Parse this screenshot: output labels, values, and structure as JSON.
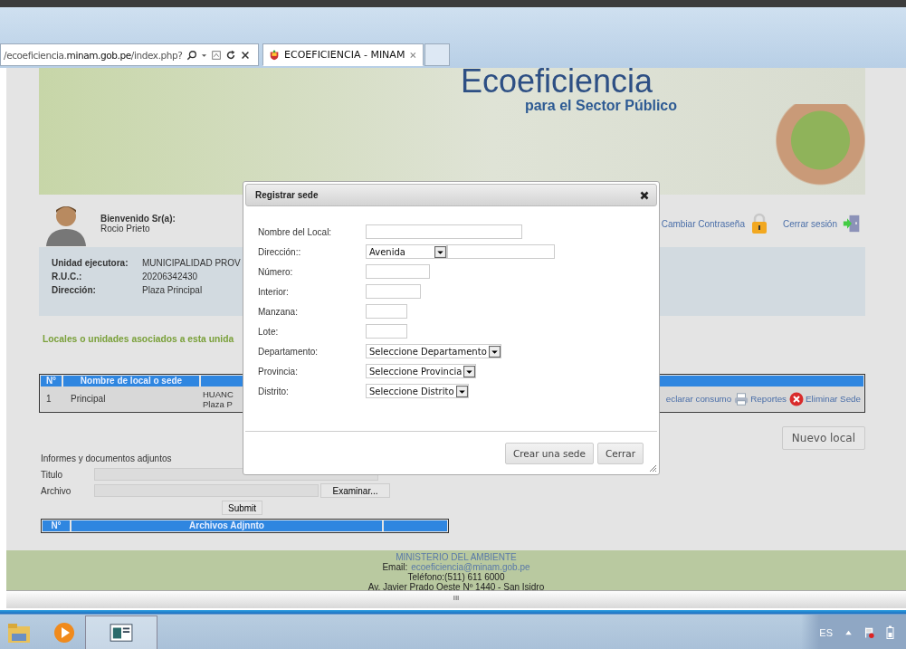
{
  "browser": {
    "address": {
      "pre": "/ecoeficiencia.",
      "domain": "minam.gob.pe",
      "post": "/index.php?"
    },
    "tabs": [
      {
        "label": "ECOEFICIENCIA - MINAM",
        "selected": true
      }
    ]
  },
  "banner": {
    "title": "Ecoeficiencia",
    "subtitle": "para el Sector Público"
  },
  "user": {
    "greeting": "Bienvenido Sr(a):",
    "name": "Rocio Prieto",
    "links": [
      "Cambiar Contraseña",
      "Cerrar sesión"
    ]
  },
  "info": [
    {
      "label": "Unidad ejecutora:",
      "value": "MUNICIPALIDAD PROV"
    },
    {
      "label": "R.U.C.:",
      "value": "20206342430"
    },
    {
      "label": "Dirección:",
      "value": "Plaza Principal"
    }
  ],
  "locales": {
    "heading": "Locales o unidades asociados a esta unida",
    "columns": [
      "N°",
      "Nombre de local o sede"
    ],
    "rows": [
      {
        "num": "1",
        "name": "Principal",
        "column_3": [
          "HUANC",
          "Plaza P"
        ],
        "actions": [
          "eclarar consumo",
          "Reportes",
          "Eliminar Sede"
        ]
      }
    ],
    "new_button": "Nuevo local"
  },
  "documents": {
    "heading": "Informes y documentos adjuntos",
    "fields": [
      {
        "label": "Titulo",
        "kind": "text"
      },
      {
        "label": "Archivo",
        "kind": "file",
        "button": "Examinar..."
      }
    ],
    "submit": "Submit",
    "columns": [
      "N°",
      "Archivos Adjnnto"
    ]
  },
  "footer": [
    {
      "kind": "org",
      "text": "MINISTERIO DEL AMBIENTE"
    },
    {
      "kind": "email",
      "label": "Email:",
      "text": "ecoeficiencia@minam.gob.pe"
    },
    {
      "kind": "plain",
      "text": "Teléfono:(511) 611 6000"
    },
    {
      "kind": "plain",
      "text": "Av. Javier Prado Oeste Nº 1440 - San Isidro"
    }
  ],
  "grip": "III",
  "dialog": {
    "title": "Registrar sede",
    "fields": [
      {
        "label": "Nombre del Local:",
        "kind": "wide-text"
      },
      {
        "label": "Dirección::",
        "kind": "select-text",
        "value": "Avenida"
      },
      {
        "label": "Número:",
        "kind": "text"
      },
      {
        "label": "Interior:",
        "kind": "short-text"
      },
      {
        "label": "Manzana:",
        "kind": "tiny-text"
      },
      {
        "label": "Lote:",
        "kind": "tiny-text"
      },
      {
        "label": "Departamento:",
        "kind": "select",
        "value": "Seleccione Departamento"
      },
      {
        "label": "Provincia:",
        "kind": "select",
        "value": "Seleccione Provincia"
      },
      {
        "label": "Distrito:",
        "kind": "select",
        "value": "Seleccione Distrito"
      }
    ],
    "buttons": [
      "Crear una sede",
      "Cerrar"
    ]
  },
  "taskbar": {
    "language": "ES"
  }
}
